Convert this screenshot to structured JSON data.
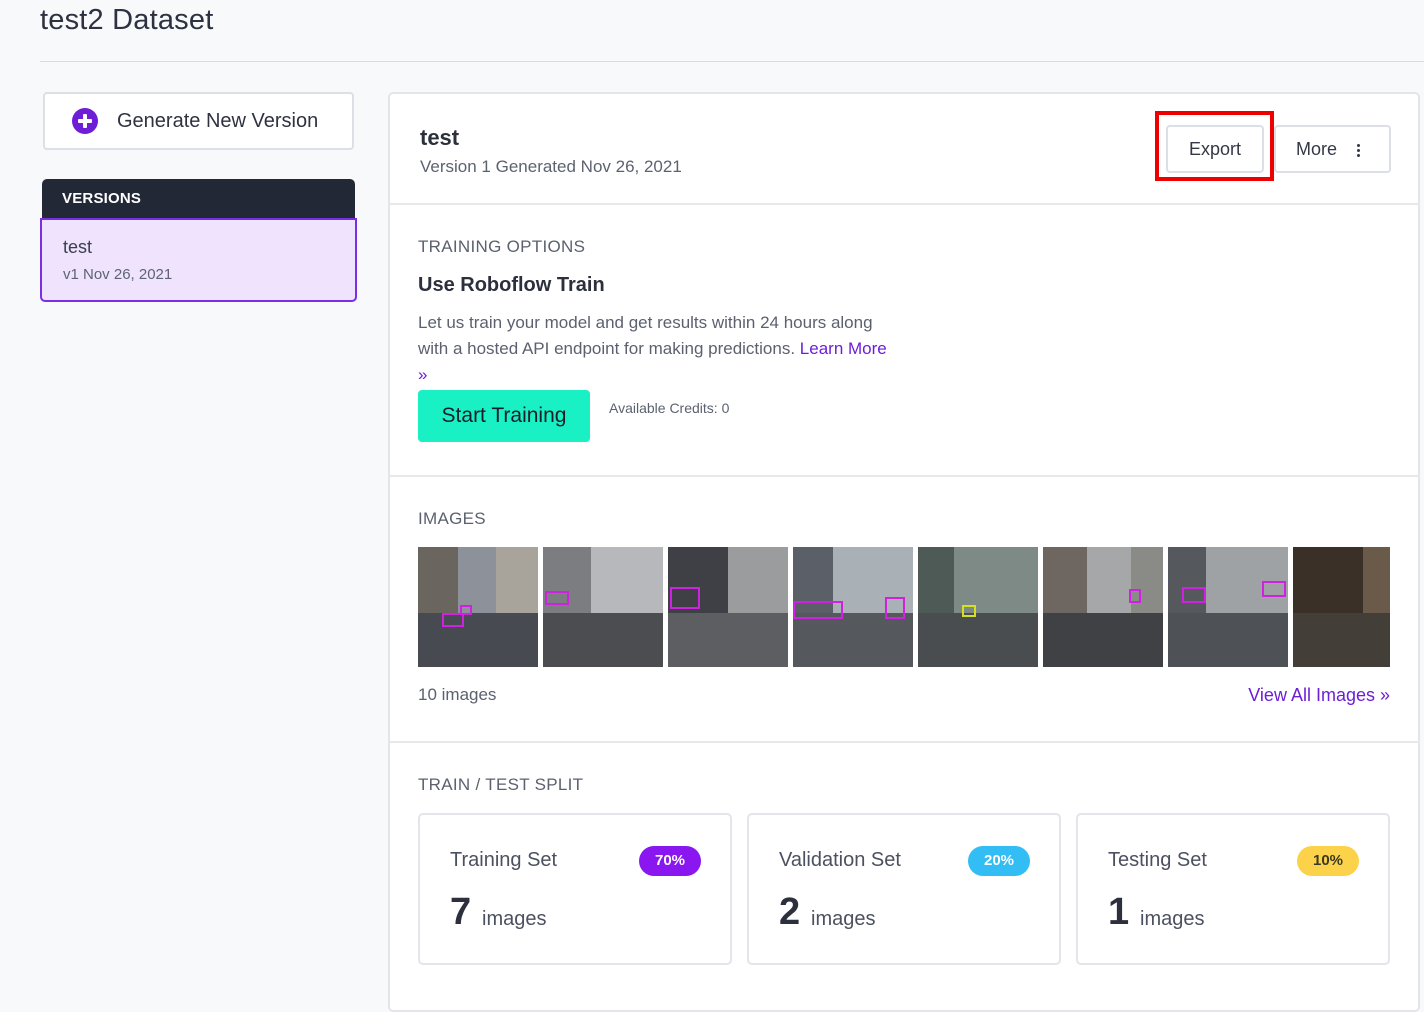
{
  "page": {
    "title": "test2 Dataset"
  },
  "sidebar": {
    "generate_label": "Generate New Version",
    "versions_header": "VERSIONS",
    "versions": [
      {
        "name": "test",
        "meta": "v1 Nov 26, 2021"
      }
    ]
  },
  "version": {
    "name": "test",
    "subtitle": "Version 1 Generated Nov 26, 2021",
    "export_label": "Export",
    "more_label": "More"
  },
  "training": {
    "section_label": "TRAINING OPTIONS",
    "title": "Use Roboflow Train",
    "description": "Let us train your model and get results within 24 hours along with a hosted API endpoint for making predictions.",
    "learn_more": "Learn More »",
    "start_label": "Start Training",
    "credits": "Available Credits: 0"
  },
  "images": {
    "section_label": "IMAGES",
    "count_text": "10 images",
    "view_all": "View All Images »"
  },
  "split": {
    "section_label": "TRAIN / TEST SPLIT",
    "sets": [
      {
        "name": "Training Set",
        "percent": "70%",
        "count": "7",
        "unit": "images",
        "badge_bg": "#8a16f0",
        "badge_fg": "#ffffff"
      },
      {
        "name": "Validation Set",
        "percent": "20%",
        "count": "2",
        "unit": "images",
        "badge_bg": "#33bdf5",
        "badge_fg": "#ffffff"
      },
      {
        "name": "Testing Set",
        "percent": "10%",
        "count": "1",
        "unit": "images",
        "badge_bg": "#fcd24a",
        "badge_fg": "#3a3a22"
      }
    ]
  },
  "colors": {
    "accent": "#6d1ed6",
    "train_button": "#19f0c4",
    "highlight": "#ee0000"
  }
}
